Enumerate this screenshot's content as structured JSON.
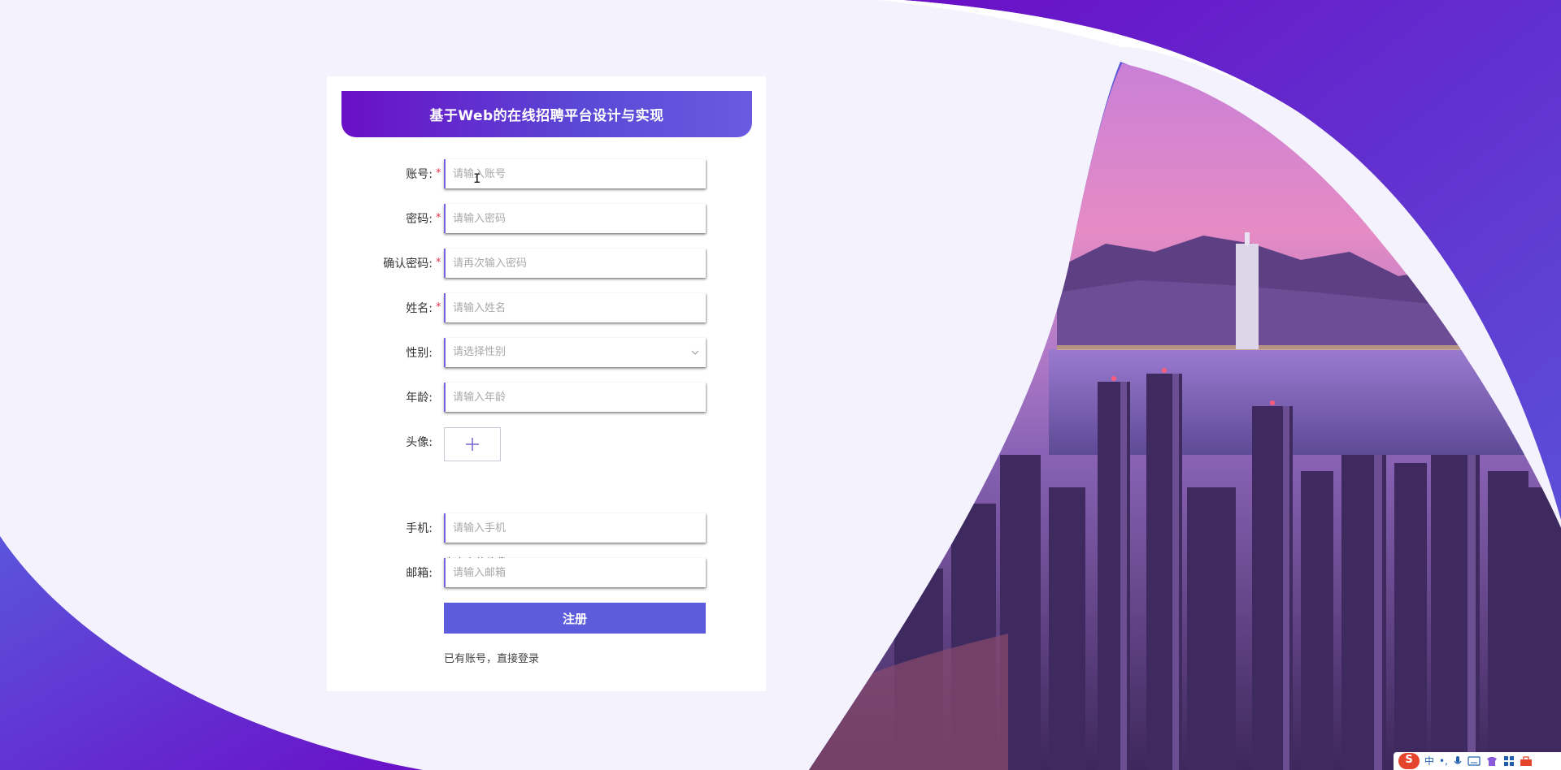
{
  "header": {
    "title": "基于Web的在线招聘平台设计与实现"
  },
  "form": {
    "account": {
      "label": "账号:",
      "placeholder": "请输入账号"
    },
    "password": {
      "label": "密码:",
      "placeholder": "请输入密码"
    },
    "confirm": {
      "label": "确认密码:",
      "placeholder": "请再次输入密码"
    },
    "name": {
      "label": "姓名:",
      "placeholder": "请输入姓名"
    },
    "gender": {
      "label": "性别:",
      "placeholder": "请选择性别"
    },
    "age": {
      "label": "年龄:",
      "placeholder": "请输入年龄"
    },
    "avatar": {
      "label": "头像:",
      "hint": "点击上传头像"
    },
    "phone": {
      "label": "手机:",
      "placeholder": "请输入手机"
    },
    "email": {
      "label": "邮箱:",
      "placeholder": "请输入邮箱"
    },
    "required_mark": "*",
    "register_label": "注册",
    "login_link": "已有账号，直接登录"
  },
  "tray": {
    "ime_logo": "S",
    "ime_mode": "中",
    "punct": "•,",
    "icons": [
      "mic-icon",
      "keyboard-icon",
      "skin-icon",
      "apps-icon",
      "toolbox-icon"
    ]
  },
  "colors": {
    "primary": "#5c5cdc",
    "header_start": "#6a0fc6",
    "header_end": "#6a5ae0",
    "required": "#e0344a",
    "page_bg": "#f4f3fd"
  }
}
